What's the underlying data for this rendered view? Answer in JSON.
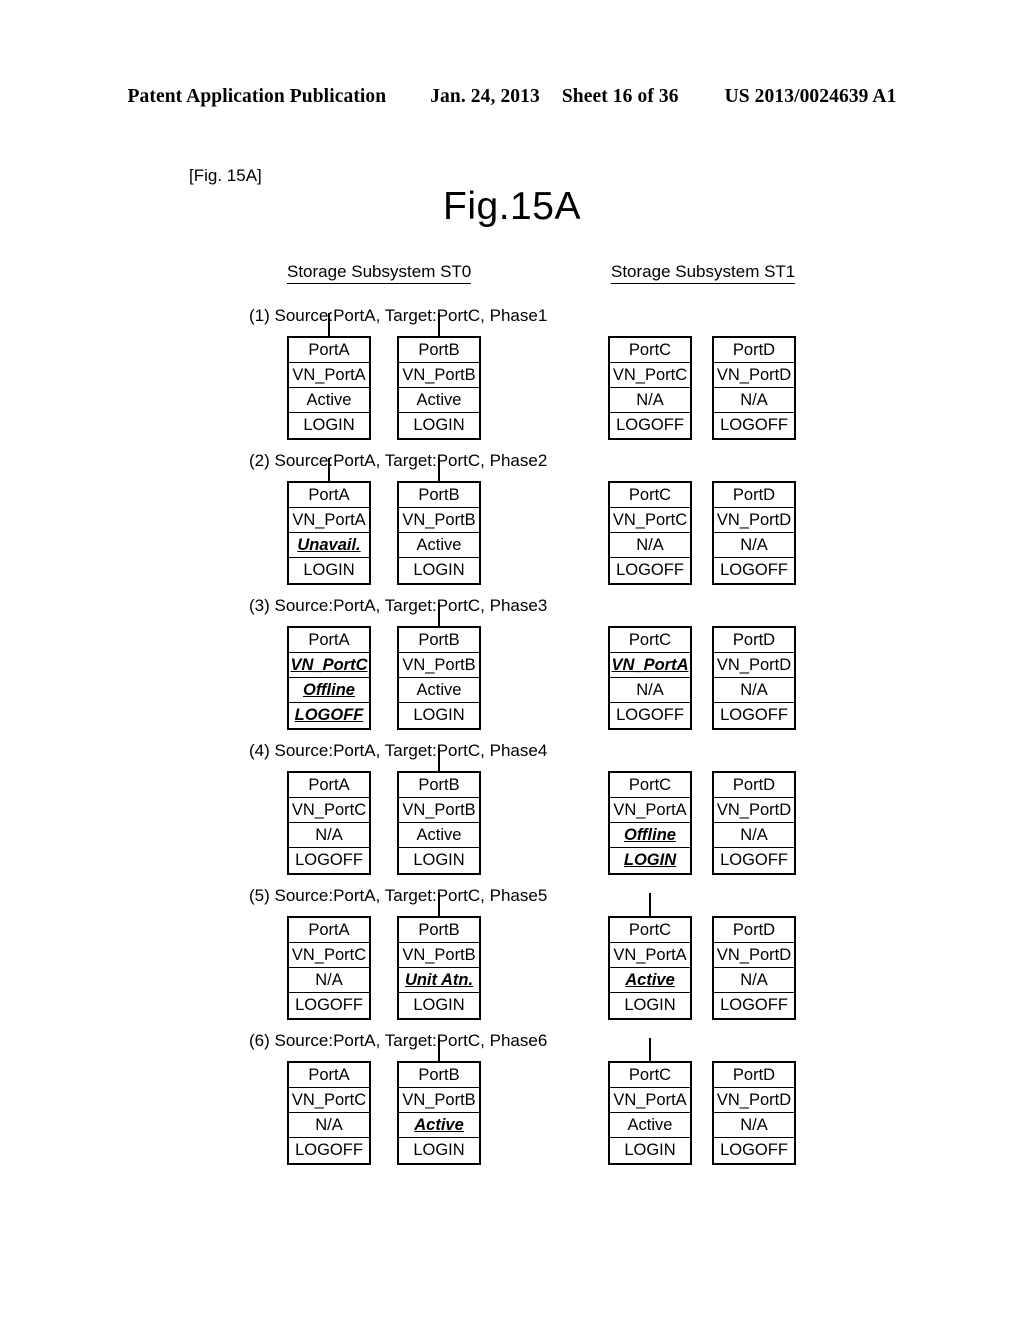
{
  "header": {
    "publication": "Patent Application Publication",
    "date": "Jan. 24, 2013",
    "sheet": "Sheet 16 of 36",
    "patent_number": "US 2013/0024639 A1"
  },
  "figure": {
    "bracket_label": "[Fig. 15A]",
    "title": "Fig.15A"
  },
  "columns": {
    "left_heading": "Storage Subsystem ST0",
    "right_heading": "Storage Subsystem ST1"
  },
  "phases": [
    {
      "label": "(1) Source:PortA, Target:PortC, Phase1",
      "boxes": [
        {
          "column": "a",
          "connector": true,
          "cells": [
            {
              "text": "PortA",
              "highlight": false
            },
            {
              "text": "VN_PortA",
              "highlight": false
            },
            {
              "text": "Active",
              "highlight": false
            },
            {
              "text": "LOGIN",
              "highlight": false
            }
          ]
        },
        {
          "column": "b",
          "connector": true,
          "cells": [
            {
              "text": "PortB",
              "highlight": false
            },
            {
              "text": "VN_PortB",
              "highlight": false
            },
            {
              "text": "Active",
              "highlight": false
            },
            {
              "text": "LOGIN",
              "highlight": false
            }
          ]
        },
        {
          "column": "c",
          "connector": false,
          "cells": [
            {
              "text": "PortC",
              "highlight": false
            },
            {
              "text": "VN_PortC",
              "highlight": false
            },
            {
              "text": "N/A",
              "highlight": false
            },
            {
              "text": "LOGOFF",
              "highlight": false
            }
          ]
        },
        {
          "column": "d",
          "connector": false,
          "cells": [
            {
              "text": "PortD",
              "highlight": false
            },
            {
              "text": "VN_PortD",
              "highlight": false
            },
            {
              "text": "N/A",
              "highlight": false
            },
            {
              "text": "LOGOFF",
              "highlight": false
            }
          ]
        }
      ]
    },
    {
      "label": "(2) Source:PortA, Target:PortC, Phase2",
      "boxes": [
        {
          "column": "a",
          "connector": true,
          "cells": [
            {
              "text": "PortA",
              "highlight": false
            },
            {
              "text": "VN_PortA",
              "highlight": false
            },
            {
              "text": "Unavail.",
              "highlight": true
            },
            {
              "text": "LOGIN",
              "highlight": false
            }
          ]
        },
        {
          "column": "b",
          "connector": true,
          "cells": [
            {
              "text": "PortB",
              "highlight": false
            },
            {
              "text": "VN_PortB",
              "highlight": false
            },
            {
              "text": "Active",
              "highlight": false
            },
            {
              "text": "LOGIN",
              "highlight": false
            }
          ]
        },
        {
          "column": "c",
          "connector": false,
          "cells": [
            {
              "text": "PortC",
              "highlight": false
            },
            {
              "text": "VN_PortC",
              "highlight": false
            },
            {
              "text": "N/A",
              "highlight": false
            },
            {
              "text": "LOGOFF",
              "highlight": false
            }
          ]
        },
        {
          "column": "d",
          "connector": false,
          "cells": [
            {
              "text": "PortD",
              "highlight": false
            },
            {
              "text": "VN_PortD",
              "highlight": false
            },
            {
              "text": "N/A",
              "highlight": false
            },
            {
              "text": "LOGOFF",
              "highlight": false
            }
          ]
        }
      ]
    },
    {
      "label": "(3) Source:PortA, Target:PortC, Phase3",
      "boxes": [
        {
          "column": "a",
          "connector": false,
          "cells": [
            {
              "text": "PortA",
              "highlight": false
            },
            {
              "text": "VN_PortC",
              "highlight": true
            },
            {
              "text": "Offline",
              "highlight": true
            },
            {
              "text": "LOGOFF",
              "highlight": true
            }
          ]
        },
        {
          "column": "b",
          "connector": true,
          "cells": [
            {
              "text": "PortB",
              "highlight": false
            },
            {
              "text": "VN_PortB",
              "highlight": false
            },
            {
              "text": "Active",
              "highlight": false
            },
            {
              "text": "LOGIN",
              "highlight": false
            }
          ]
        },
        {
          "column": "c",
          "connector": false,
          "cells": [
            {
              "text": "PortC",
              "highlight": false
            },
            {
              "text": "VN_PortA",
              "highlight": true
            },
            {
              "text": "N/A",
              "highlight": false
            },
            {
              "text": "LOGOFF",
              "highlight": false
            }
          ]
        },
        {
          "column": "d",
          "connector": false,
          "cells": [
            {
              "text": "PortD",
              "highlight": false
            },
            {
              "text": "VN_PortD",
              "highlight": false
            },
            {
              "text": "N/A",
              "highlight": false
            },
            {
              "text": "LOGOFF",
              "highlight": false
            }
          ]
        }
      ]
    },
    {
      "label": "(4) Source:PortA, Target:PortC, Phase4",
      "boxes": [
        {
          "column": "a",
          "connector": false,
          "cells": [
            {
              "text": "PortA",
              "highlight": false
            },
            {
              "text": "VN_PortC",
              "highlight": false
            },
            {
              "text": "N/A",
              "highlight": false
            },
            {
              "text": "LOGOFF",
              "highlight": false
            }
          ]
        },
        {
          "column": "b",
          "connector": true,
          "cells": [
            {
              "text": "PortB",
              "highlight": false
            },
            {
              "text": "VN_PortB",
              "highlight": false
            },
            {
              "text": "Active",
              "highlight": false
            },
            {
              "text": "LOGIN",
              "highlight": false
            }
          ]
        },
        {
          "column": "c",
          "connector": false,
          "cells": [
            {
              "text": "PortC",
              "highlight": false
            },
            {
              "text": "VN_PortA",
              "highlight": false
            },
            {
              "text": "Offline",
              "highlight": true
            },
            {
              "text": "LOGIN",
              "highlight": true
            }
          ]
        },
        {
          "column": "d",
          "connector": false,
          "cells": [
            {
              "text": "PortD",
              "highlight": false
            },
            {
              "text": "VN_PortD",
              "highlight": false
            },
            {
              "text": "N/A",
              "highlight": false
            },
            {
              "text": "LOGOFF",
              "highlight": false
            }
          ]
        }
      ]
    },
    {
      "label": "(5) Source:PortA, Target:PortC, Phase5",
      "boxes": [
        {
          "column": "a",
          "connector": false,
          "cells": [
            {
              "text": "PortA",
              "highlight": false
            },
            {
              "text": "VN_PortC",
              "highlight": false
            },
            {
              "text": "N/A",
              "highlight": false
            },
            {
              "text": "LOGOFF",
              "highlight": false
            }
          ]
        },
        {
          "column": "b",
          "connector": true,
          "cells": [
            {
              "text": "PortB",
              "highlight": false
            },
            {
              "text": "VN_PortB",
              "highlight": false
            },
            {
              "text": "Unit Atn.",
              "highlight": true
            },
            {
              "text": "LOGIN",
              "highlight": false
            }
          ]
        },
        {
          "column": "c",
          "connector": true,
          "cells": [
            {
              "text": "PortC",
              "highlight": false
            },
            {
              "text": "VN_PortA",
              "highlight": false
            },
            {
              "text": "Active",
              "highlight": true
            },
            {
              "text": "LOGIN",
              "highlight": false
            }
          ]
        },
        {
          "column": "d",
          "connector": false,
          "cells": [
            {
              "text": "PortD",
              "highlight": false
            },
            {
              "text": "VN_PortD",
              "highlight": false
            },
            {
              "text": "N/A",
              "highlight": false
            },
            {
              "text": "LOGOFF",
              "highlight": false
            }
          ]
        }
      ]
    },
    {
      "label": "(6) Source:PortA, Target:PortC, Phase6",
      "boxes": [
        {
          "column": "a",
          "connector": false,
          "cells": [
            {
              "text": "PortA",
              "highlight": false
            },
            {
              "text": "VN_PortC",
              "highlight": false
            },
            {
              "text": "N/A",
              "highlight": false
            },
            {
              "text": "LOGOFF",
              "highlight": false
            }
          ]
        },
        {
          "column": "b",
          "connector": true,
          "cells": [
            {
              "text": "PortB",
              "highlight": false
            },
            {
              "text": "VN_PortB",
              "highlight": false
            },
            {
              "text": "Active",
              "highlight": true
            },
            {
              "text": "LOGIN",
              "highlight": false
            }
          ]
        },
        {
          "column": "c",
          "connector": true,
          "cells": [
            {
              "text": "PortC",
              "highlight": false
            },
            {
              "text": "VN_PortA",
              "highlight": false
            },
            {
              "text": "Active",
              "highlight": false
            },
            {
              "text": "LOGIN",
              "highlight": false
            }
          ]
        },
        {
          "column": "d",
          "connector": false,
          "cells": [
            {
              "text": "PortD",
              "highlight": false
            },
            {
              "text": "VN_PortD",
              "highlight": false
            },
            {
              "text": "N/A",
              "highlight": false
            },
            {
              "text": "LOGOFF",
              "highlight": false
            }
          ]
        }
      ]
    }
  ],
  "layout": {
    "phase_top_positions": [
      306,
      451,
      596,
      741,
      886,
      1031
    ],
    "box_offset_from_label": 30
  }
}
